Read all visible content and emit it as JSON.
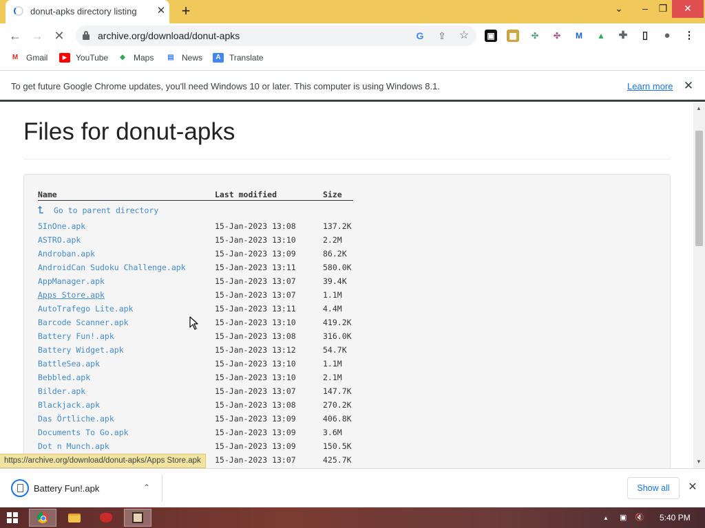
{
  "tab": {
    "title": "donut-apks directory listing",
    "close": "✕"
  },
  "newtab": "+",
  "window": {
    "chevron": "⌄",
    "minimize": "–",
    "restore": "❐",
    "close": "✕"
  },
  "toolbar": {
    "back": "←",
    "forward": "→",
    "reload": "✕",
    "url": "archive.org/download/donut-apks"
  },
  "omnibox_icons": {
    "google": "G",
    "share": "⇪",
    "star": "☆"
  },
  "extensions": [
    {
      "name": "roblox-extension-icon",
      "glyph": "▣",
      "color": "#111111"
    },
    {
      "name": "image-extension-icon",
      "glyph": "▦",
      "color": "#c9a640"
    },
    {
      "name": "slack-extension-icon",
      "glyph": "✣",
      "color": "#4a9d7c"
    },
    {
      "name": "slack-alt-extension-icon",
      "glyph": "✣",
      "color": "#b04a8c"
    },
    {
      "name": "malwarebytes-extension-icon",
      "glyph": "M",
      "color": "#1764d1"
    },
    {
      "name": "green-extension-icon",
      "glyph": "▲",
      "color": "#2eae58"
    },
    {
      "name": "puzzle-extension-icon",
      "glyph": "✚",
      "color": "#5f6368"
    },
    {
      "name": "sidepanel-icon",
      "glyph": "▯",
      "color": "#202124"
    },
    {
      "name": "profile-icon",
      "glyph": "●",
      "color": "#5f6368"
    },
    {
      "name": "menu-icon",
      "glyph": "⋮",
      "color": "#202124"
    }
  ],
  "bookmarks": [
    {
      "label": "Gmail",
      "glyph": "M",
      "color": "#d93025"
    },
    {
      "label": "YouTube",
      "glyph": "▶",
      "color": "#ff0000"
    },
    {
      "label": "Maps",
      "glyph": "◆",
      "color": "#34a853"
    },
    {
      "label": "News",
      "glyph": "▤",
      "color": "#4285f4"
    },
    {
      "label": "Translate",
      "glyph": "A",
      "color": "#4285f4"
    }
  ],
  "infobar": {
    "message": "To get future Google Chrome updates, you'll need Windows 10 or later. This computer is using Windows 8.1.",
    "link": "Learn more",
    "close": "✕"
  },
  "page": {
    "title": "Files for donut-apks",
    "columns": {
      "name": "Name",
      "modified": "Last modified",
      "size": "Size"
    },
    "parent": {
      "arrow": "⮤",
      "label": "Go to parent directory"
    },
    "files": [
      {
        "name": "5InOne.apk",
        "date": "15-Jan-2023 13:08",
        "size": "137.2K"
      },
      {
        "name": "ASTRO.apk",
        "date": "15-Jan-2023 13:10",
        "size": "2.2M"
      },
      {
        "name": "Androban.apk",
        "date": "15-Jan-2023 13:09",
        "size": "86.2K"
      },
      {
        "name": "AndroidCan Sudoku Challenge.apk",
        "date": "15-Jan-2023 13:11",
        "size": "580.0K"
      },
      {
        "name": "AppManager.apk",
        "date": "15-Jan-2023 13:07",
        "size": "39.4K"
      },
      {
        "name": "Apps Store.apk",
        "date": "15-Jan-2023 13:07",
        "size": "1.1M"
      },
      {
        "name": "AutoTrafego Lite.apk",
        "date": "15-Jan-2023 13:11",
        "size": "4.4M"
      },
      {
        "name": "Barcode Scanner.apk",
        "date": "15-Jan-2023 13:10",
        "size": "419.2K"
      },
      {
        "name": "Battery Fun!.apk",
        "date": "15-Jan-2023 13:08",
        "size": "316.0K"
      },
      {
        "name": "Battery Widget.apk",
        "date": "15-Jan-2023 13:12",
        "size": "54.7K"
      },
      {
        "name": "BattleSea.apk",
        "date": "15-Jan-2023 13:10",
        "size": "1.1M"
      },
      {
        "name": "Bebbled.apk",
        "date": "15-Jan-2023 13:10",
        "size": "2.1M"
      },
      {
        "name": "Bilder.apk",
        "date": "15-Jan-2023 13:07",
        "size": "147.7K"
      },
      {
        "name": "Blackjack.apk",
        "date": "15-Jan-2023 13:08",
        "size": "270.2K"
      },
      {
        "name": "Das Örtliche.apk",
        "date": "15-Jan-2023 13:09",
        "size": "406.8K"
      },
      {
        "name": "Documents To Go.apk",
        "date": "15-Jan-2023 13:09",
        "size": "3.6M"
      },
      {
        "name": "Dot n Munch.apk",
        "date": "15-Jan-2023 13:09",
        "size": "150.5K"
      },
      {
        "name": "",
        "date": "15-Jan-2023 13:07",
        "size": "425.7K"
      }
    ]
  },
  "scrollbar": {
    "up": "▲",
    "down": "▼"
  },
  "status_url": "https://archive.org/download/donut-apks/Apps Store.apk",
  "downloads": {
    "file": "Battery Fun!.apk",
    "caret": "⌃",
    "show_all": "Show all",
    "close": "✕"
  },
  "taskbar": {
    "time": "5:40 PM",
    "tray_up": "▲",
    "tray_network": "▣",
    "tray_volume": "🔇"
  }
}
